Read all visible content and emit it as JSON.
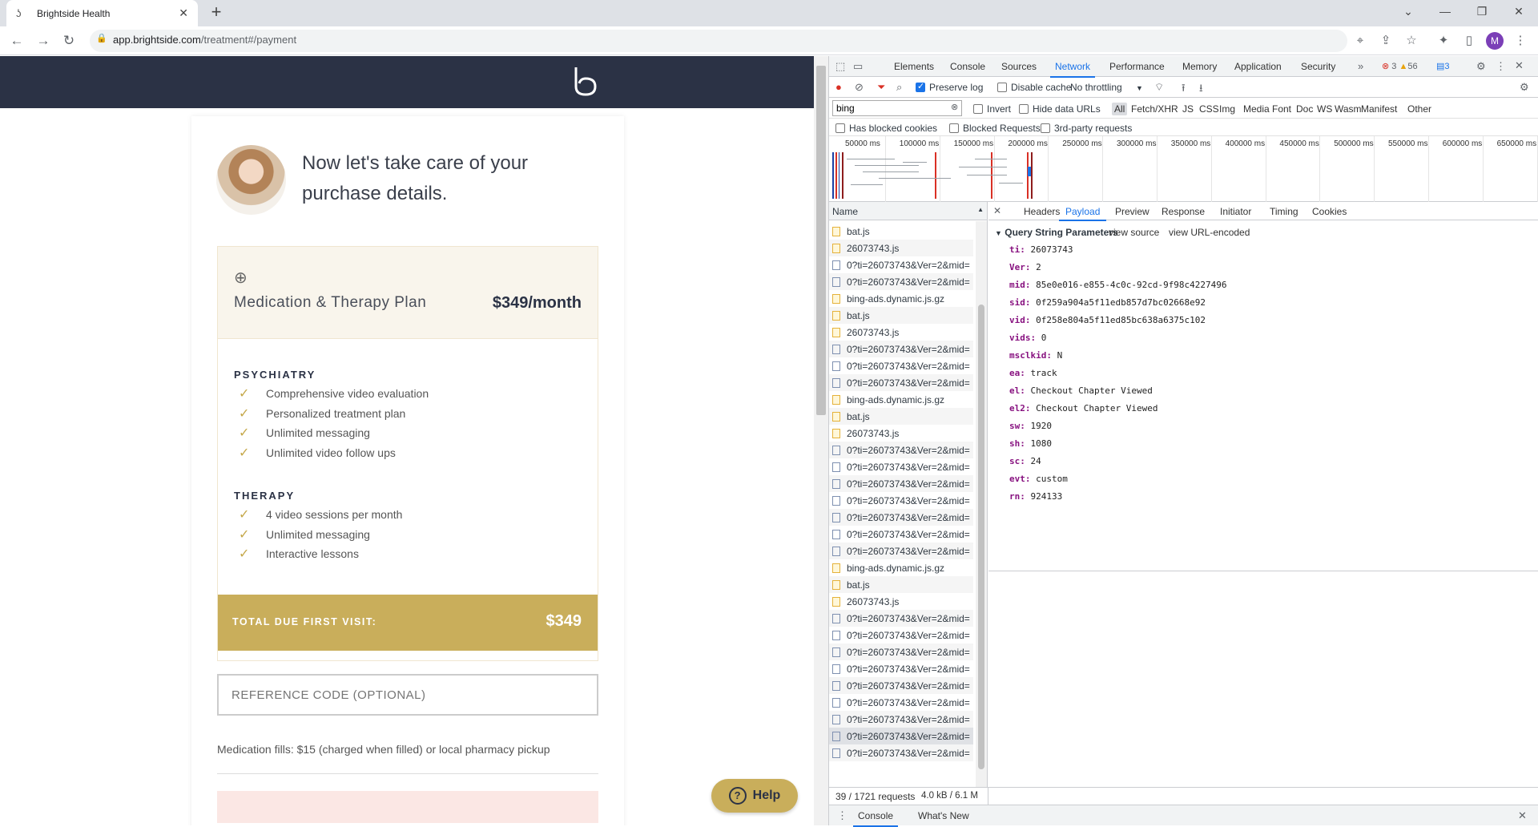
{
  "browser": {
    "tab_title": "Brightside Health",
    "url_host": "app.brightside.com",
    "url_path": "/treatment#/payment",
    "profile_initial": "M"
  },
  "page": {
    "intro": "Now let's take care of your purchase details.",
    "plan_name": "Medication & Therapy Plan",
    "plan_price": "$349/month",
    "psychiatry_title": "PSYCHIATRY",
    "psychiatry_items": [
      "Comprehensive video evaluation",
      "Personalized treatment plan",
      "Unlimited messaging",
      "Unlimited video follow ups"
    ],
    "therapy_title": "THERAPY",
    "therapy_items": [
      "4 video sessions per month",
      "Unlimited messaging",
      "Interactive lessons"
    ],
    "total_label": "TOTAL DUE FIRST VISIT:",
    "total_amount": "$349",
    "reference_placeholder": "REFERENCE CODE (OPTIONAL)",
    "medication_note": "Medication fills: $15 (charged when filled) or local pharmacy pickup",
    "help_label": "Help"
  },
  "devtools": {
    "tabs": [
      "Elements",
      "Console",
      "Sources",
      "Network",
      "Performance",
      "Memory",
      "Application",
      "Security"
    ],
    "errors": "3",
    "warnings": "56",
    "messages": "3",
    "preserve_log": "Preserve log",
    "disable_cache": "Disable cache",
    "throttling": "No throttling",
    "filter_value": "bing",
    "invert": "Invert",
    "hide_data_urls": "Hide data URLs",
    "type_filters": [
      "All",
      "Fetch/XHR",
      "JS",
      "CSS",
      "Img",
      "Media",
      "Font",
      "Doc",
      "WS",
      "Wasm",
      "Manifest",
      "Other"
    ],
    "has_blocked_cookies": "Has blocked cookies",
    "blocked_requests": "Blocked Requests",
    "third_party": "3rd-party requests",
    "timeline_ticks": [
      "50000 ms",
      "100000 ms",
      "150000 ms",
      "200000 ms",
      "250000 ms",
      "300000 ms",
      "350000 ms",
      "400000 ms",
      "450000 ms",
      "500000 ms",
      "550000 ms",
      "600000 ms",
      "650000 ms"
    ],
    "name_header": "Name",
    "requests": [
      {
        "name": "bat.js",
        "kind": "js"
      },
      {
        "name": "26073743.js",
        "kind": "js"
      },
      {
        "name": "0?ti=26073743&Ver=2&mid=",
        "kind": "doc"
      },
      {
        "name": "0?ti=26073743&Ver=2&mid=",
        "kind": "doc"
      },
      {
        "name": "bing-ads.dynamic.js.gz",
        "kind": "js"
      },
      {
        "name": "bat.js",
        "kind": "js"
      },
      {
        "name": "26073743.js",
        "kind": "js"
      },
      {
        "name": "0?ti=26073743&Ver=2&mid=",
        "kind": "doc"
      },
      {
        "name": "0?ti=26073743&Ver=2&mid=",
        "kind": "doc"
      },
      {
        "name": "0?ti=26073743&Ver=2&mid=",
        "kind": "doc"
      },
      {
        "name": "bing-ads.dynamic.js.gz",
        "kind": "js"
      },
      {
        "name": "bat.js",
        "kind": "js"
      },
      {
        "name": "26073743.js",
        "kind": "js"
      },
      {
        "name": "0?ti=26073743&Ver=2&mid=",
        "kind": "doc"
      },
      {
        "name": "0?ti=26073743&Ver=2&mid=",
        "kind": "doc"
      },
      {
        "name": "0?ti=26073743&Ver=2&mid=",
        "kind": "doc"
      },
      {
        "name": "0?ti=26073743&Ver=2&mid=",
        "kind": "doc"
      },
      {
        "name": "0?ti=26073743&Ver=2&mid=",
        "kind": "doc"
      },
      {
        "name": "0?ti=26073743&Ver=2&mid=",
        "kind": "doc"
      },
      {
        "name": "0?ti=26073743&Ver=2&mid=",
        "kind": "doc"
      },
      {
        "name": "bing-ads.dynamic.js.gz",
        "kind": "js"
      },
      {
        "name": "bat.js",
        "kind": "js"
      },
      {
        "name": "26073743.js",
        "kind": "js"
      },
      {
        "name": "0?ti=26073743&Ver=2&mid=",
        "kind": "doc"
      },
      {
        "name": "0?ti=26073743&Ver=2&mid=",
        "kind": "doc"
      },
      {
        "name": "0?ti=26073743&Ver=2&mid=",
        "kind": "doc"
      },
      {
        "name": "0?ti=26073743&Ver=2&mid=",
        "kind": "doc"
      },
      {
        "name": "0?ti=26073743&Ver=2&mid=",
        "kind": "doc"
      },
      {
        "name": "0?ti=26073743&Ver=2&mid=",
        "kind": "doc"
      },
      {
        "name": "0?ti=26073743&Ver=2&mid=",
        "kind": "doc"
      },
      {
        "name": "0?ti=26073743&Ver=2&mid=",
        "kind": "doc"
      },
      {
        "name": "0?ti=26073743&Ver=2&mid=",
        "kind": "doc"
      }
    ],
    "selected_request_index": 30,
    "detail_tabs": [
      "Headers",
      "Payload",
      "Preview",
      "Response",
      "Initiator",
      "Timing",
      "Cookies"
    ],
    "active_detail_tab": "Payload",
    "qsp_title": "Query String Parameters",
    "view_source": "view source",
    "view_url_encoded": "view URL-encoded",
    "params": [
      {
        "k": "ti:",
        "v": "26073743"
      },
      {
        "k": "Ver:",
        "v": "2"
      },
      {
        "k": "mid:",
        "v": "85e0e016-e855-4c0c-92cd-9f98c4227496"
      },
      {
        "k": "sid:",
        "v": "0f259a904a5f11edb857d7bc02668e92"
      },
      {
        "k": "vid:",
        "v": "0f258e804a5f11ed85bc638a6375c102"
      },
      {
        "k": "vids:",
        "v": "0"
      },
      {
        "k": "msclkid:",
        "v": "N"
      },
      {
        "k": "ea:",
        "v": "track"
      },
      {
        "k": "el:",
        "v": "Checkout Chapter Viewed"
      },
      {
        "k": "el2:",
        "v": "Checkout Chapter Viewed"
      },
      {
        "k": "sw:",
        "v": "1920"
      },
      {
        "k": "sh:",
        "v": "1080"
      },
      {
        "k": "sc:",
        "v": "24"
      },
      {
        "k": "evt:",
        "v": "custom"
      },
      {
        "k": "rn:",
        "v": "924133"
      }
    ],
    "status": "39 / 1721 requests",
    "transferred": "4.0 kB / 6.1 M",
    "drawer_tabs": [
      "Console",
      "What's New"
    ]
  }
}
